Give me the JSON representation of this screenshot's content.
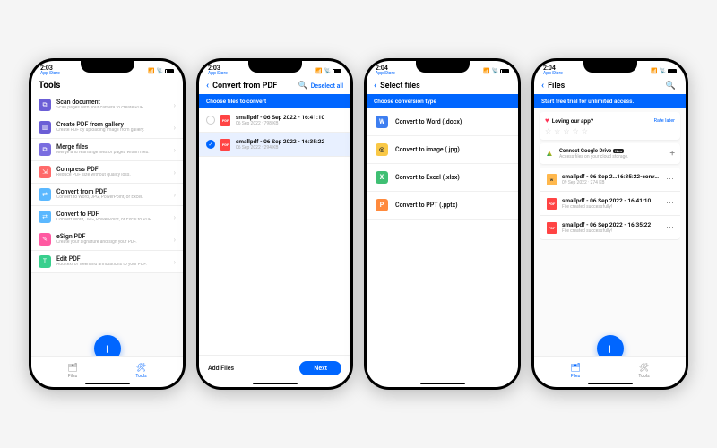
{
  "status": {
    "time1": "2:03",
    "time2": "2:04",
    "back_label": "App Store"
  },
  "phone1": {
    "header": "Tools",
    "tools": [
      {
        "title": "Scan document",
        "sub": "Scan pages with your camera to create PDF."
      },
      {
        "title": "Create PDF from gallery",
        "sub": "Create PDF by uploading image from gallery."
      },
      {
        "title": "Merge files",
        "sub": "Merge and rearrange files or pages within files."
      },
      {
        "title": "Compress PDF",
        "sub": "Reduce PDF size without quality loss."
      },
      {
        "title": "Convert from PDF",
        "sub": "Convert to Word, JPG, PowerPoint, or Excel."
      },
      {
        "title": "Convert to PDF",
        "sub": "Convert Word, JPG, PowerPoint, or Excel to PDF."
      },
      {
        "title": "eSign PDF",
        "sub": "Create your signature and sign your PDF."
      },
      {
        "title": "Edit PDF",
        "sub": "Add text or freehand annotations to your PDF."
      }
    ],
    "nav": {
      "files": "Files",
      "tools": "Tools"
    }
  },
  "phone2": {
    "title": "Convert from PDF",
    "deselect": "Deselect all",
    "banner": "Choose files to convert",
    "files": [
      {
        "name": "smallpdf - 06 Sep 2022 - 16:41:10",
        "meta": "06 Sep 2022 · 798 KB",
        "selected": false
      },
      {
        "name": "smallpdf - 06 Sep 2022 - 16:35:22",
        "meta": "06 Sep 2022 · 294 KB",
        "selected": true
      }
    ],
    "add_files": "Add Files",
    "next": "Next"
  },
  "phone3": {
    "title": "Select files",
    "banner": "Choose conversion type",
    "types": [
      {
        "label": "Convert to Word (.docx)",
        "letter": "W",
        "cls": "w"
      },
      {
        "label": "Convert to image (.jpg)",
        "letter": "◎",
        "cls": "i"
      },
      {
        "label": "Convert to Excel (.xlsx)",
        "letter": "X",
        "cls": "x"
      },
      {
        "label": "Convert to PPT (.pptx)",
        "letter": "P",
        "cls": "p"
      }
    ]
  },
  "phone4": {
    "title": "Files",
    "banner": "Start free trial for unlimited access.",
    "rate": {
      "title": "Loving our app?",
      "later": "Rate later"
    },
    "drive": {
      "title": "Connect Google Drive",
      "badge": "New",
      "sub": "Access files on your cloud storage."
    },
    "files": [
      {
        "name": "smallpdf - 06 Sep 2…16:35:22-converted",
        "meta": "09 Sep 2022 · 274 KB",
        "type": "docx"
      },
      {
        "name": "smallpdf - 06 Sep 2022 - 16:41:10",
        "meta": "File created successfully!",
        "type": "pdf"
      },
      {
        "name": "smallpdf - 06 Sep 2022 - 16:35:22",
        "meta": "File created successfully!",
        "type": "pdf"
      }
    ],
    "nav": {
      "files": "Files",
      "tools": "Tools"
    }
  }
}
